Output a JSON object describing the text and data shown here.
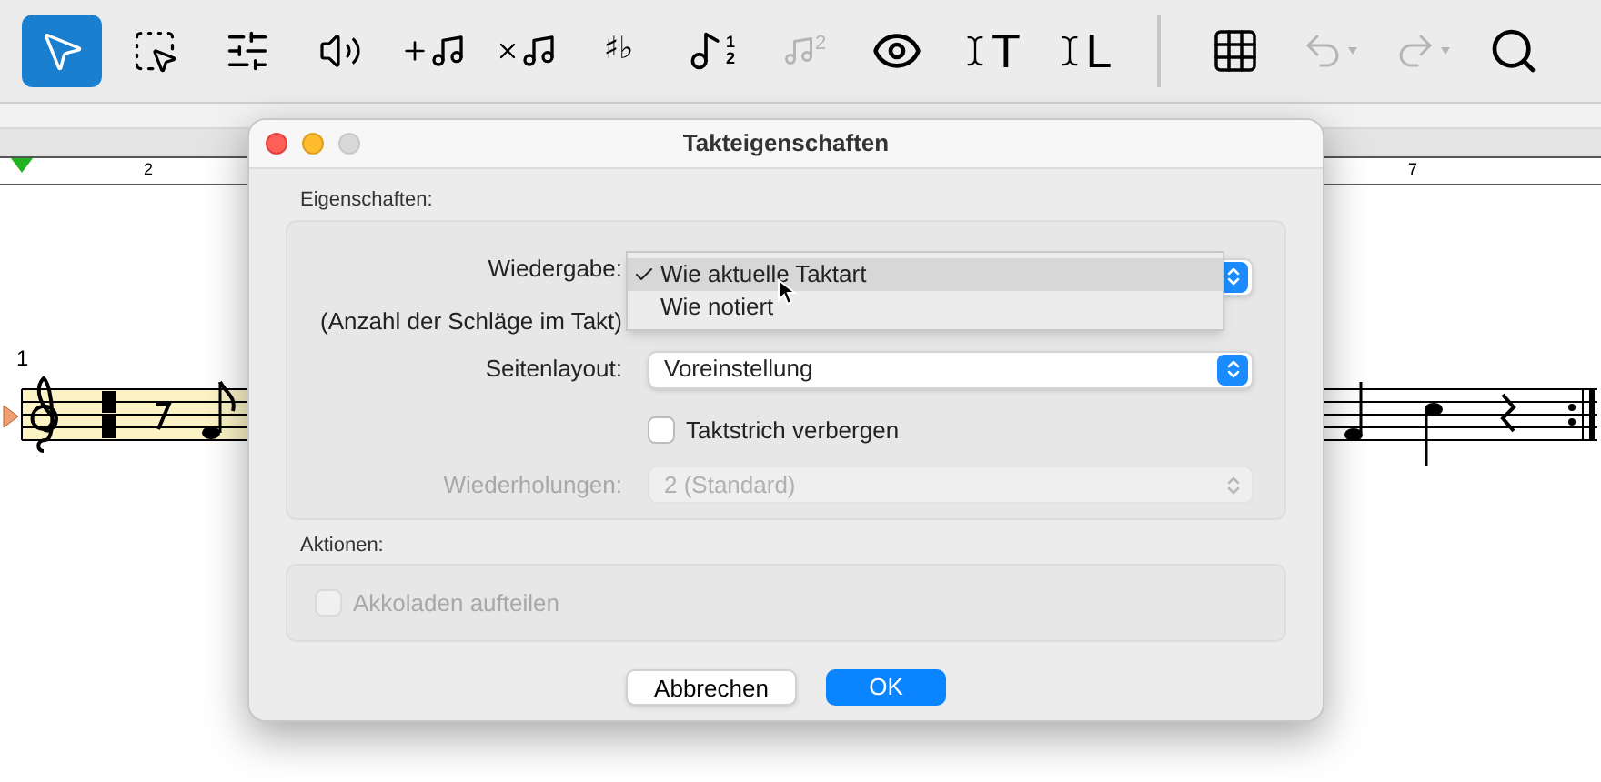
{
  "toolbar": [
    {
      "kind": "select",
      "selected": true,
      "disabled": false
    },
    {
      "kind": "marquee",
      "selected": false,
      "disabled": false
    },
    {
      "kind": "sliders",
      "selected": false,
      "disabled": false
    },
    {
      "kind": "speaker",
      "selected": false,
      "disabled": false
    },
    {
      "kind": "add-note",
      "selected": false,
      "disabled": false
    },
    {
      "kind": "remove-note",
      "selected": false,
      "disabled": false
    },
    {
      "kind": "accidentals",
      "selected": false,
      "disabled": false,
      "glyph": "♯♭"
    },
    {
      "kind": "tuplet",
      "selected": false,
      "disabled": false,
      "glyph": "1 2"
    },
    {
      "kind": "voice",
      "selected": false,
      "disabled": true,
      "glyph": "2"
    },
    {
      "kind": "eye",
      "selected": false,
      "disabled": false
    },
    {
      "kind": "text",
      "selected": false,
      "disabled": false,
      "glyph": "T"
    },
    {
      "kind": "text",
      "selected": false,
      "disabled": false,
      "glyph": "L"
    },
    {
      "kind": "separator"
    },
    {
      "kind": "chord-grid",
      "selected": false,
      "disabled": false
    },
    {
      "kind": "undo",
      "selected": false,
      "disabled": true
    },
    {
      "kind": "redo",
      "selected": false,
      "disabled": true
    },
    {
      "kind": "search",
      "selected": false,
      "disabled": false
    }
  ],
  "score": {
    "ruler_labels": [
      "2",
      "7"
    ],
    "measure_number": "1"
  },
  "dialog": {
    "title": "Takteigenschaften",
    "properties_group": {
      "label": "Eigenschaften:",
      "playback": {
        "label": "Wiedergabe:",
        "sublabel": "(Anzahl der Schläge im Takt)",
        "menu": [
          {
            "label": "Wie aktuelle Taktart",
            "selected": true
          },
          {
            "label": "Wie notiert",
            "selected": false
          }
        ]
      },
      "page_layout": {
        "label": "Seitenlayout:",
        "value": "Voreinstellung"
      },
      "hide_barline": {
        "label": "Taktstrich verbergen",
        "checked": false,
        "disabled": false
      },
      "repeats": {
        "label": "Wiederholungen:",
        "value": "2 (Standard)",
        "disabled": true
      }
    },
    "actions_group": {
      "label": "Aktionen:",
      "split_systems": {
        "label": "Akkoladen aufteilen",
        "checked": false,
        "disabled": true
      }
    },
    "buttons": [
      {
        "label": "Abbrechen",
        "kind": "secondary"
      },
      {
        "label": "OK",
        "kind": "primary"
      }
    ]
  }
}
